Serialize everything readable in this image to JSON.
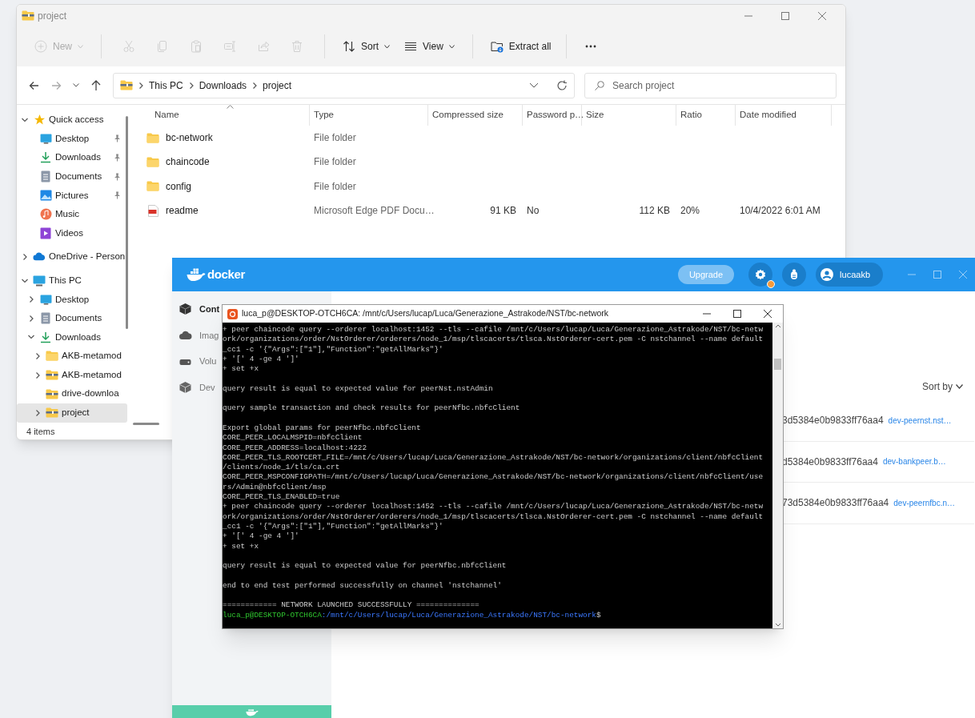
{
  "explorer": {
    "title": "project",
    "toolbar": [
      {
        "kind": "new",
        "label": "New",
        "disabled": true
      },
      {
        "kind": "cut",
        "disabled": true
      },
      {
        "kind": "copy",
        "disabled": true
      },
      {
        "kind": "paste",
        "disabled": true
      },
      {
        "kind": "rename",
        "disabled": true
      },
      {
        "kind": "share",
        "disabled": true
      },
      {
        "kind": "delete",
        "disabled": true
      },
      {
        "kind": "sort",
        "label": "Sort",
        "disabled": false
      },
      {
        "kind": "view",
        "label": "View",
        "disabled": false
      },
      {
        "kind": "extract",
        "label": "Extract all",
        "disabled": false
      },
      {
        "kind": "more",
        "disabled": false
      }
    ],
    "nav": {
      "back_disabled": false,
      "forward_disabled": true
    },
    "breadcrumb": [
      "This PC",
      "Downloads",
      "project"
    ],
    "search": {
      "placeholder": "Search project"
    },
    "tree": [
      {
        "label": "Quick access",
        "kind": "star",
        "expanded": true,
        "selected": false,
        "children": [
          {
            "label": "Desktop",
            "kind": "desktop",
            "pinned": true,
            "selected": false
          },
          {
            "label": "Downloads",
            "kind": "download",
            "pinned": true,
            "selected": false
          },
          {
            "label": "Documents",
            "kind": "document",
            "pinned": true,
            "selected": false
          },
          {
            "label": "Pictures",
            "kind": "picture",
            "pinned": true,
            "selected": false
          },
          {
            "label": "Music",
            "kind": "music",
            "pinned": false,
            "selected": false
          },
          {
            "label": "Videos",
            "kind": "video",
            "pinned": false,
            "selected": false
          }
        ]
      },
      {
        "label": "OneDrive - Person",
        "kind": "cloud",
        "expanded": false,
        "selected": false
      },
      {
        "label": "This PC",
        "kind": "pc",
        "expanded": true,
        "selected": false,
        "children": [
          {
            "label": "Desktop",
            "kind": "desktop",
            "expanded": false,
            "selected": false
          },
          {
            "label": "Documents",
            "kind": "document",
            "expanded": false,
            "selected": false
          },
          {
            "label": "Downloads",
            "kind": "download",
            "expanded": true,
            "selected": false,
            "children": [
              {
                "label": "AKB-metamod",
                "kind": "folder",
                "expanded": false,
                "selected": false
              },
              {
                "label": "AKB-metamod",
                "kind": "zip",
                "expanded": false,
                "selected": false
              },
              {
                "label": "drive-downloa",
                "kind": "zip",
                "selected": false
              },
              {
                "label": "project",
                "kind": "zip",
                "expanded": false,
                "selected": true
              }
            ]
          }
        ]
      }
    ],
    "columns": [
      "Name",
      "Type",
      "Compressed size",
      "Password p…",
      "Size",
      "Ratio",
      "Date modified"
    ],
    "files": [
      {
        "kind": "folder",
        "name": "bc-network",
        "type": "File folder"
      },
      {
        "kind": "folder",
        "name": "chaincode",
        "type": "File folder"
      },
      {
        "kind": "folder",
        "name": "config",
        "type": "File folder"
      },
      {
        "kind": "pdf",
        "name": "readme",
        "type": "Microsoft Edge PDF Docu…",
        "compressed_size": "91 KB",
        "password": "No",
        "size": "112 KB",
        "ratio": "20%",
        "date_modified": "10/4/2022 6:01 AM"
      }
    ],
    "status_bar": "4 items"
  },
  "docker": {
    "logo_text": "docker",
    "upgrade": "Upgrade",
    "settings_badge": true,
    "user": "lucaakb",
    "sidebar": [
      {
        "label": "Cont",
        "kind": "containers",
        "selected": true
      },
      {
        "label": "Imag",
        "kind": "images",
        "selected": false
      },
      {
        "label": "Volu",
        "kind": "volumes",
        "selected": false
      },
      {
        "label": "Dev",
        "kind": "dev",
        "selected": false
      }
    ],
    "sort_by": "Sort by",
    "rows": [
      {
        "id": "3d5384e0b9833ff76aa4",
        "name": "dev-peernst.nst…"
      },
      {
        "id": "d5384e0b9833ff76aa4",
        "name": "dev-bankpeer.b…"
      },
      {
        "id": "73d5384e0b9833ff76aa4",
        "name": "dev-peernfbc.n…"
      }
    ]
  },
  "terminal": {
    "title": "luca_p@DESKTOP-OTCH6CA: /mnt/c/Users/lucap/Luca/Generazione_Astrakode/NST/bc-network",
    "lines": [
      {
        "kind": "text",
        "text": "+ peer chaincode query --orderer localhost:1452 --tls --cafile /mnt/c/Users/lucap/Luca/Generazione_Astrakode/NST/bc-netw"
      },
      {
        "kind": "text",
        "text": "ork/organizations/order/NstOrderer/orderers/node_1/msp/tlscacerts/tlsca.NstOrderer-cert.pem -C nstchannel --name default"
      },
      {
        "kind": "text",
        "text": "_cc1 -c '{\"Args\":[\"1\"],\"Function\":\"getAllMarks\"}'"
      },
      {
        "kind": "text",
        "text": "+ '[' 4 -ge 4 ']'"
      },
      {
        "kind": "text",
        "text": "+ set +x"
      },
      {
        "kind": "blank"
      },
      {
        "kind": "text",
        "text": "query result is equal to expected value for peerNst.nstAdmin"
      },
      {
        "kind": "blank"
      },
      {
        "kind": "text",
        "text": "query sample transaction and check results for peerNfbc.nbfcClient"
      },
      {
        "kind": "blank"
      },
      {
        "kind": "text",
        "text": "Export global params for peerNfbc.nbfcClient"
      },
      {
        "kind": "text",
        "text": "CORE_PEER_LOCALMSPID=nbfcClient"
      },
      {
        "kind": "text",
        "text": "CORE_PEER_ADDRESS=localhost:4222"
      },
      {
        "kind": "text",
        "text": "CORE_PEER_TLS_ROOTCERT_FILE=/mnt/c/Users/lucap/Luca/Generazione_Astrakode/NST/bc-network/organizations/client/nbfcClient"
      },
      {
        "kind": "text",
        "text": "/clients/node_1/tls/ca.crt"
      },
      {
        "kind": "text",
        "text": "CORE_PEER_MSPCONFIGPATH=/mnt/c/Users/lucap/Luca/Generazione_Astrakode/NST/bc-network/organizations/client/nbfcClient/use"
      },
      {
        "kind": "text",
        "text": "rs/Admin@nbfcClient/msp"
      },
      {
        "kind": "text",
        "text": "CORE_PEER_TLS_ENABLED=true"
      },
      {
        "kind": "text",
        "text": "+ peer chaincode query --orderer localhost:1452 --tls --cafile /mnt/c/Users/lucap/Luca/Generazione_Astrakode/NST/bc-netw"
      },
      {
        "kind": "text",
        "text": "ork/organizations/order/NstOrderer/orderers/node_1/msp/tlscacerts/tlsca.NstOrderer-cert.pem -C nstchannel --name default"
      },
      {
        "kind": "text",
        "text": "_cc1 -c '{\"Args\":[\"1\"],\"Function\":\"getAllMarks\"}'"
      },
      {
        "kind": "text",
        "text": "+ '[' 4 -ge 4 ']'"
      },
      {
        "kind": "text",
        "text": "+ set +x"
      },
      {
        "kind": "blank"
      },
      {
        "kind": "text",
        "text": "query result is equal to expected value for peerNfbc.nbfcClient"
      },
      {
        "kind": "blank"
      },
      {
        "kind": "text",
        "text": "end to end test performed successfully on channel 'nstchannel'"
      },
      {
        "kind": "blank"
      },
      {
        "kind": "text",
        "text": "============ NETWORK LAUNCHED SUCCESSFULLY =============="
      },
      {
        "kind": "prompt",
        "user": "luca_p@DESKTOP-OTCH6CA",
        "path": ":/mnt/c/Users/lucap/Luca/Generazione_Astrakode/NST/bc-network",
        "symbol": "$"
      }
    ]
  }
}
